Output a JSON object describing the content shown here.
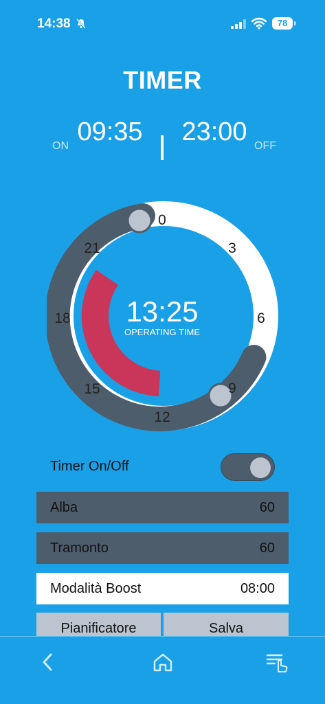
{
  "status": {
    "time": "14:38",
    "battery": "78"
  },
  "title": "TIMER",
  "schedule": {
    "on_label": "ON",
    "on_time": "09:35",
    "off_label": "OFF",
    "off_time": "23:00"
  },
  "dial": {
    "center_time": "13:25",
    "center_label": "OPERATING TIME",
    "hour_marks": [
      "0",
      "3",
      "6",
      "9",
      "12",
      "15",
      "18",
      "21"
    ]
  },
  "timer_toggle": {
    "label": "Timer On/Off",
    "state": "on"
  },
  "rows": [
    {
      "label": "Alba",
      "value": "60"
    },
    {
      "label": "Tramonto",
      "value": "60"
    },
    {
      "label": "Modalità Boost",
      "value": "08:00"
    }
  ],
  "buttons": {
    "scheduler": "Pianificatore",
    "save": "Salva"
  },
  "colors": {
    "background": "#1AA0E6",
    "dark_slate": "#4E5D6C",
    "knob": "#BBC4CF",
    "accent_red": "#C9365A"
  },
  "nav": {
    "left": "back-chevron-icon",
    "center": "home-icon",
    "right": "menu-touch-icon"
  }
}
